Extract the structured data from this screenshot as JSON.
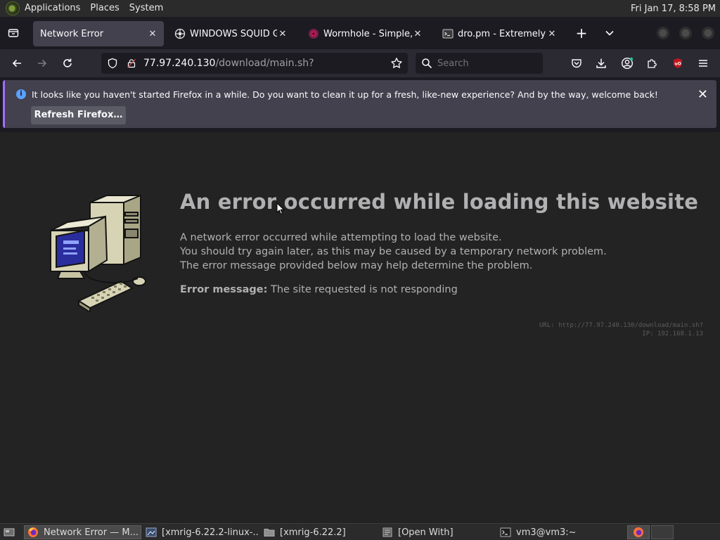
{
  "top_panel": {
    "menus": [
      "Applications",
      "Places",
      "System"
    ],
    "clock": "Fri Jan 17,  8:58 PM"
  },
  "tabs": [
    {
      "title": "Network Error",
      "active": true,
      "icon": "none"
    },
    {
      "title": "WINDOWS SQUID GA",
      "active": false,
      "icon": "squid-icon"
    },
    {
      "title": "Wormhole - Simple, p",
      "active": false,
      "icon": "wormhole-icon"
    },
    {
      "title": "dro.pm - Extremely Sh",
      "active": false,
      "icon": "terminal-favicon-icon"
    }
  ],
  "navbar": {
    "url_host": "77.97.240.130",
    "url_path": "/download/main.sh?",
    "search_placeholder": "Search"
  },
  "notification": {
    "message": "It looks like you haven't started Firefox in a while. Do you want to clean it up for a fresh, like-new experience? And by the way, welcome back!",
    "button_label": "Refresh Firefox…"
  },
  "error_page": {
    "title": "An error occurred while loading this website",
    "lines": [
      "A network error occurred while attempting to load the website.",
      "You should try again later, as this may be caused by a temporary network problem.",
      "The error message provided below may help determine the problem."
    ],
    "message_label": "Error message:",
    "message_value": "The site requested is not responding",
    "tech_url": "URL: http://77.97.240.130/download/main.sh?",
    "tech_ip": "IP: 192.168.1.13"
  },
  "taskbar": {
    "items": [
      {
        "label": "Network Error — M...",
        "active": true,
        "icon": "firefox-icon"
      },
      {
        "label": "[xmrig-6.22.2-linux-...",
        "active": false,
        "icon": "image-viewer-icon"
      },
      {
        "label": "[xmrig-6.22.2]",
        "active": false,
        "icon": "folder-icon"
      },
      {
        "label": "[Open With]",
        "active": false,
        "icon": "dialog-icon"
      },
      {
        "label": "vm3@vm3:~",
        "active": false,
        "icon": "terminal-icon"
      }
    ]
  },
  "colors": {
    "accent_purple": "#a56cff",
    "info_blue": "#5ba0ff",
    "ublock_red": "#c0171e",
    "firefox_orange": "#ff7139"
  }
}
